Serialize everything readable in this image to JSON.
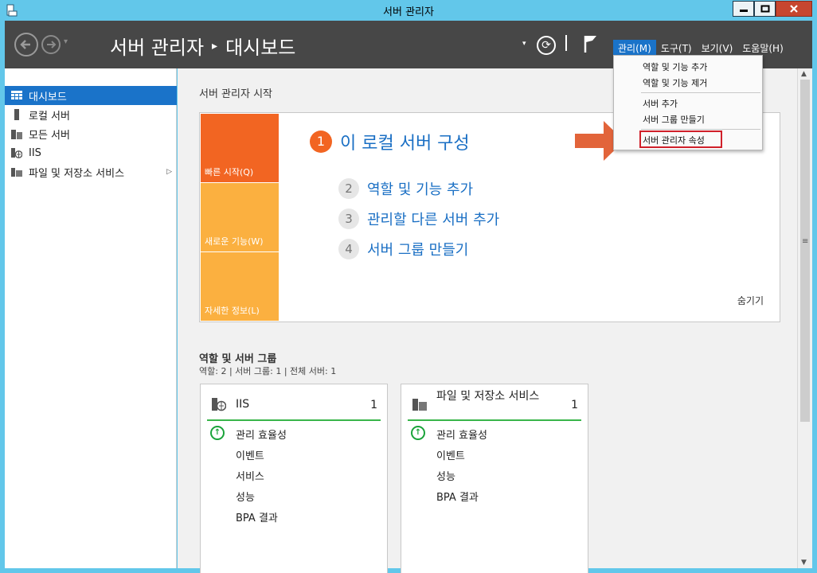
{
  "window": {
    "title": "서버 관리자"
  },
  "header": {
    "breadcrumb_root": "서버 관리자",
    "breadcrumb_sep": "▸",
    "breadcrumb_page": "대시보드",
    "menu": [
      "관리(M)",
      "도구(T)",
      "보기(V)",
      "도움말(H)"
    ]
  },
  "sidebar": {
    "items": [
      {
        "label": "대시보드",
        "icon": "dashboard-icon"
      },
      {
        "label": "로컬 서버",
        "icon": "server-icon"
      },
      {
        "label": "모든 서버",
        "icon": "servers-icon"
      },
      {
        "label": "IIS",
        "icon": "iis-icon"
      },
      {
        "label": "파일 및 저장소 서비스",
        "icon": "file-storage-icon"
      }
    ]
  },
  "quickstart": {
    "title": "서버 관리자 시작",
    "tiles": [
      "빠른 시작(Q)",
      "새로운 기능(W)",
      "자세한 정보(L)"
    ],
    "step1": {
      "num": "1",
      "label": "이 로컬 서버 구성"
    },
    "steps": [
      {
        "num": "2",
        "label": "역할 및 기능 추가"
      },
      {
        "num": "3",
        "label": "관리할 다른 서버 추가"
      },
      {
        "num": "4",
        "label": "서버 그룹 만들기"
      }
    ],
    "hide": "숨기기"
  },
  "roles": {
    "title": "역할 및 서버 그룹",
    "summary": "역할: 2   |   서버 그룹: 1   |   전체 서버: 1",
    "cards": [
      {
        "name": "IIS",
        "count": "1",
        "rows": [
          "관리 효율성",
          "이벤트",
          "서비스",
          "성능",
          "BPA 결과"
        ]
      },
      {
        "name": "파일 및 저장소 서비스",
        "count": "1",
        "rows": [
          "관리 효율성",
          "이벤트",
          "성능",
          "BPA 결과"
        ]
      }
    ]
  },
  "manage_menu": {
    "items": [
      "역할 및 기능 추가",
      "역할 및 기능 제거",
      "서버 추가",
      "서버 그룹 만들기",
      "서버 관리자 속성"
    ]
  },
  "colors": {
    "accent": "#1a73c9",
    "orange": "#f26522",
    "amber": "#fbb040",
    "header": "#474747"
  }
}
